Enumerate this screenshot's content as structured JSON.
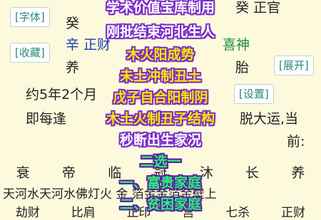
{
  "side_buttons": {
    "font": "[字体]",
    "favorite": "[收藏]",
    "expand": "[展开]",
    "settings": "[设置]"
  },
  "base": {
    "row1_left": "癸",
    "row1_right": "癸 正官",
    "row2_left": "辛 正财",
    "row2_right": "喜神",
    "row3_left": "养",
    "row3_right": "胎",
    "row4": "约5年2个月",
    "row5_left": "即每逢",
    "row5_right": "脱大运,当",
    "row6": "前:",
    "twelve_stages": [
      "衰",
      "帝",
      "临",
      "冠",
      "沐",
      "长",
      "养"
    ],
    "nayin_row": "天河水天河水佛灯火 金 箔金金箔金壁上",
    "bottom_row": [
      "劫财",
      "比肩",
      "正印",
      "宫",
      "七杀",
      "正财"
    ]
  },
  "overlay": {
    "lines": [
      {
        "text": "学术价值宝库制用",
        "style": "white"
      },
      {
        "text": "刚批结束河北生人",
        "style": "white"
      },
      {
        "text": "木火阳成势",
        "style": "yellow"
      },
      {
        "text": "未土冲制丑土",
        "style": "yellow"
      },
      {
        "text": "戊子自合阳制阴",
        "style": "yellow"
      },
      {
        "text": "木土火制丑子结构",
        "style": "yellow"
      },
      {
        "text": "秒断出生家况",
        "style": "white"
      },
      {
        "text": "二选一",
        "style": "green"
      },
      {
        "text": "一、富贵家庭",
        "style": "green"
      },
      {
        "text": "二、贫困家庭",
        "style": "green"
      }
    ]
  },
  "colors": {
    "background": "#fdf9dc",
    "button_text": "#2a8a78",
    "overlay_outline": "#7b2fc9",
    "highlight_blue": "#1a3fb0",
    "highlight_red": "#d23a1a"
  }
}
